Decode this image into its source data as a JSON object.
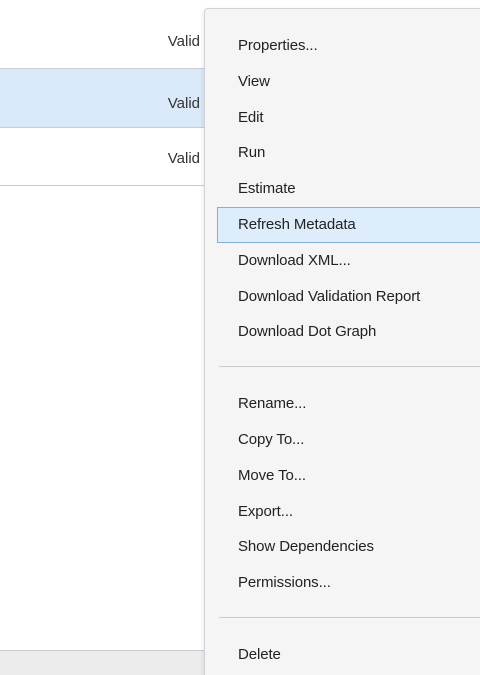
{
  "table": {
    "rows": [
      {
        "status": "Valid"
      },
      {
        "status": "Valid"
      },
      {
        "status": "Valid"
      }
    ]
  },
  "context_menu": {
    "group1": [
      {
        "label": "Properties..."
      },
      {
        "label": "View"
      },
      {
        "label": "Edit"
      },
      {
        "label": "Run"
      },
      {
        "label": "Estimate"
      },
      {
        "label": "Refresh Metadata",
        "highlighted": true
      },
      {
        "label": "Download XML..."
      },
      {
        "label": "Download Validation Report"
      },
      {
        "label": "Download Dot Graph"
      }
    ],
    "group2": [
      {
        "label": "Rename..."
      },
      {
        "label": "Copy To..."
      },
      {
        "label": "Move To..."
      },
      {
        "label": "Export..."
      },
      {
        "label": "Show Dependencies"
      },
      {
        "label": "Permissions..."
      }
    ],
    "group3": [
      {
        "label": "Delete"
      }
    ]
  },
  "colors": {
    "selected_row": "#d9e9f9",
    "highlight_bg": "#ddedfb",
    "highlight_border": "#7fb0e0",
    "menu_bg": "#f5f5f5"
  }
}
